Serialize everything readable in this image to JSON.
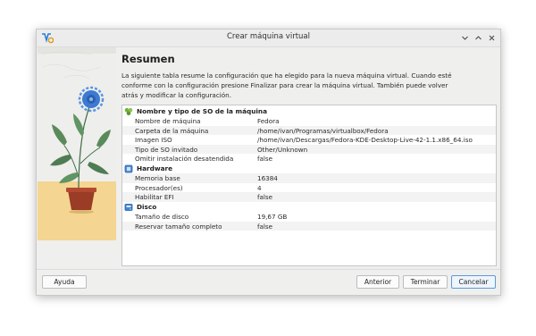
{
  "window": {
    "title": "Crear máquina virtual"
  },
  "content": {
    "heading": "Resumen",
    "description": "La siguiente tabla resume la configuración que ha elegido para la nueva máquina virtual. Cuando esté conforme con la configuración presione Finalizar para crear la máquina virtual. También puede volver atrás y modificar la configuración."
  },
  "summary": {
    "groups": [
      {
        "icon": "os-type-icon",
        "label": "Nombre y tipo de SO de la máquina",
        "rows": [
          {
            "key": "Nombre de máquina",
            "value": "Fedora"
          },
          {
            "key": "Carpeta de la máquina",
            "value": "/home/ivan/Programas/virtualbox/Fedora"
          },
          {
            "key": "Imagen ISO",
            "value": "/home/ivan/Descargas/Fedora-KDE-Desktop-Live-42-1.1.x86_64.iso"
          },
          {
            "key": "Tipo de SO invitado",
            "value": "Other/Unknown"
          },
          {
            "key": "Omitir instalación desatendida",
            "value": "false"
          }
        ]
      },
      {
        "icon": "hardware-icon",
        "label": "Hardware",
        "rows": [
          {
            "key": "Memoria base",
            "value": "16384"
          },
          {
            "key": "Procesador(es)",
            "value": "4"
          },
          {
            "key": "Habilitar EFI",
            "value": "false"
          }
        ]
      },
      {
        "icon": "disk-icon",
        "label": "Disco",
        "rows": [
          {
            "key": "Tamaño de disco",
            "value": "19,67 GB"
          },
          {
            "key": "Reservar tamaño completo",
            "value": "false"
          }
        ]
      }
    ]
  },
  "buttons": {
    "help": "Ayuda",
    "back": "Anterior",
    "finish": "Terminar",
    "cancel": "Cancelar"
  }
}
